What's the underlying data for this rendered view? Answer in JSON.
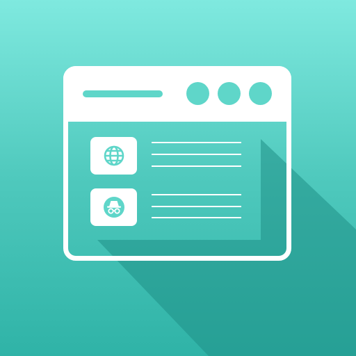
{
  "app_icon": {
    "name": "browser-app-icon",
    "colors": {
      "background_top": "#7fe9df",
      "background_bottom": "#2fb3a7",
      "foreground": "#ffffff",
      "accent": "#5fd6c9",
      "shadow": "#1f8f86"
    },
    "window": {
      "control_dots": 3,
      "list_items": [
        {
          "icon": "globe-icon",
          "text_lines": 3
        },
        {
          "icon": "incognito-icon",
          "text_lines": 3
        }
      ]
    }
  }
}
